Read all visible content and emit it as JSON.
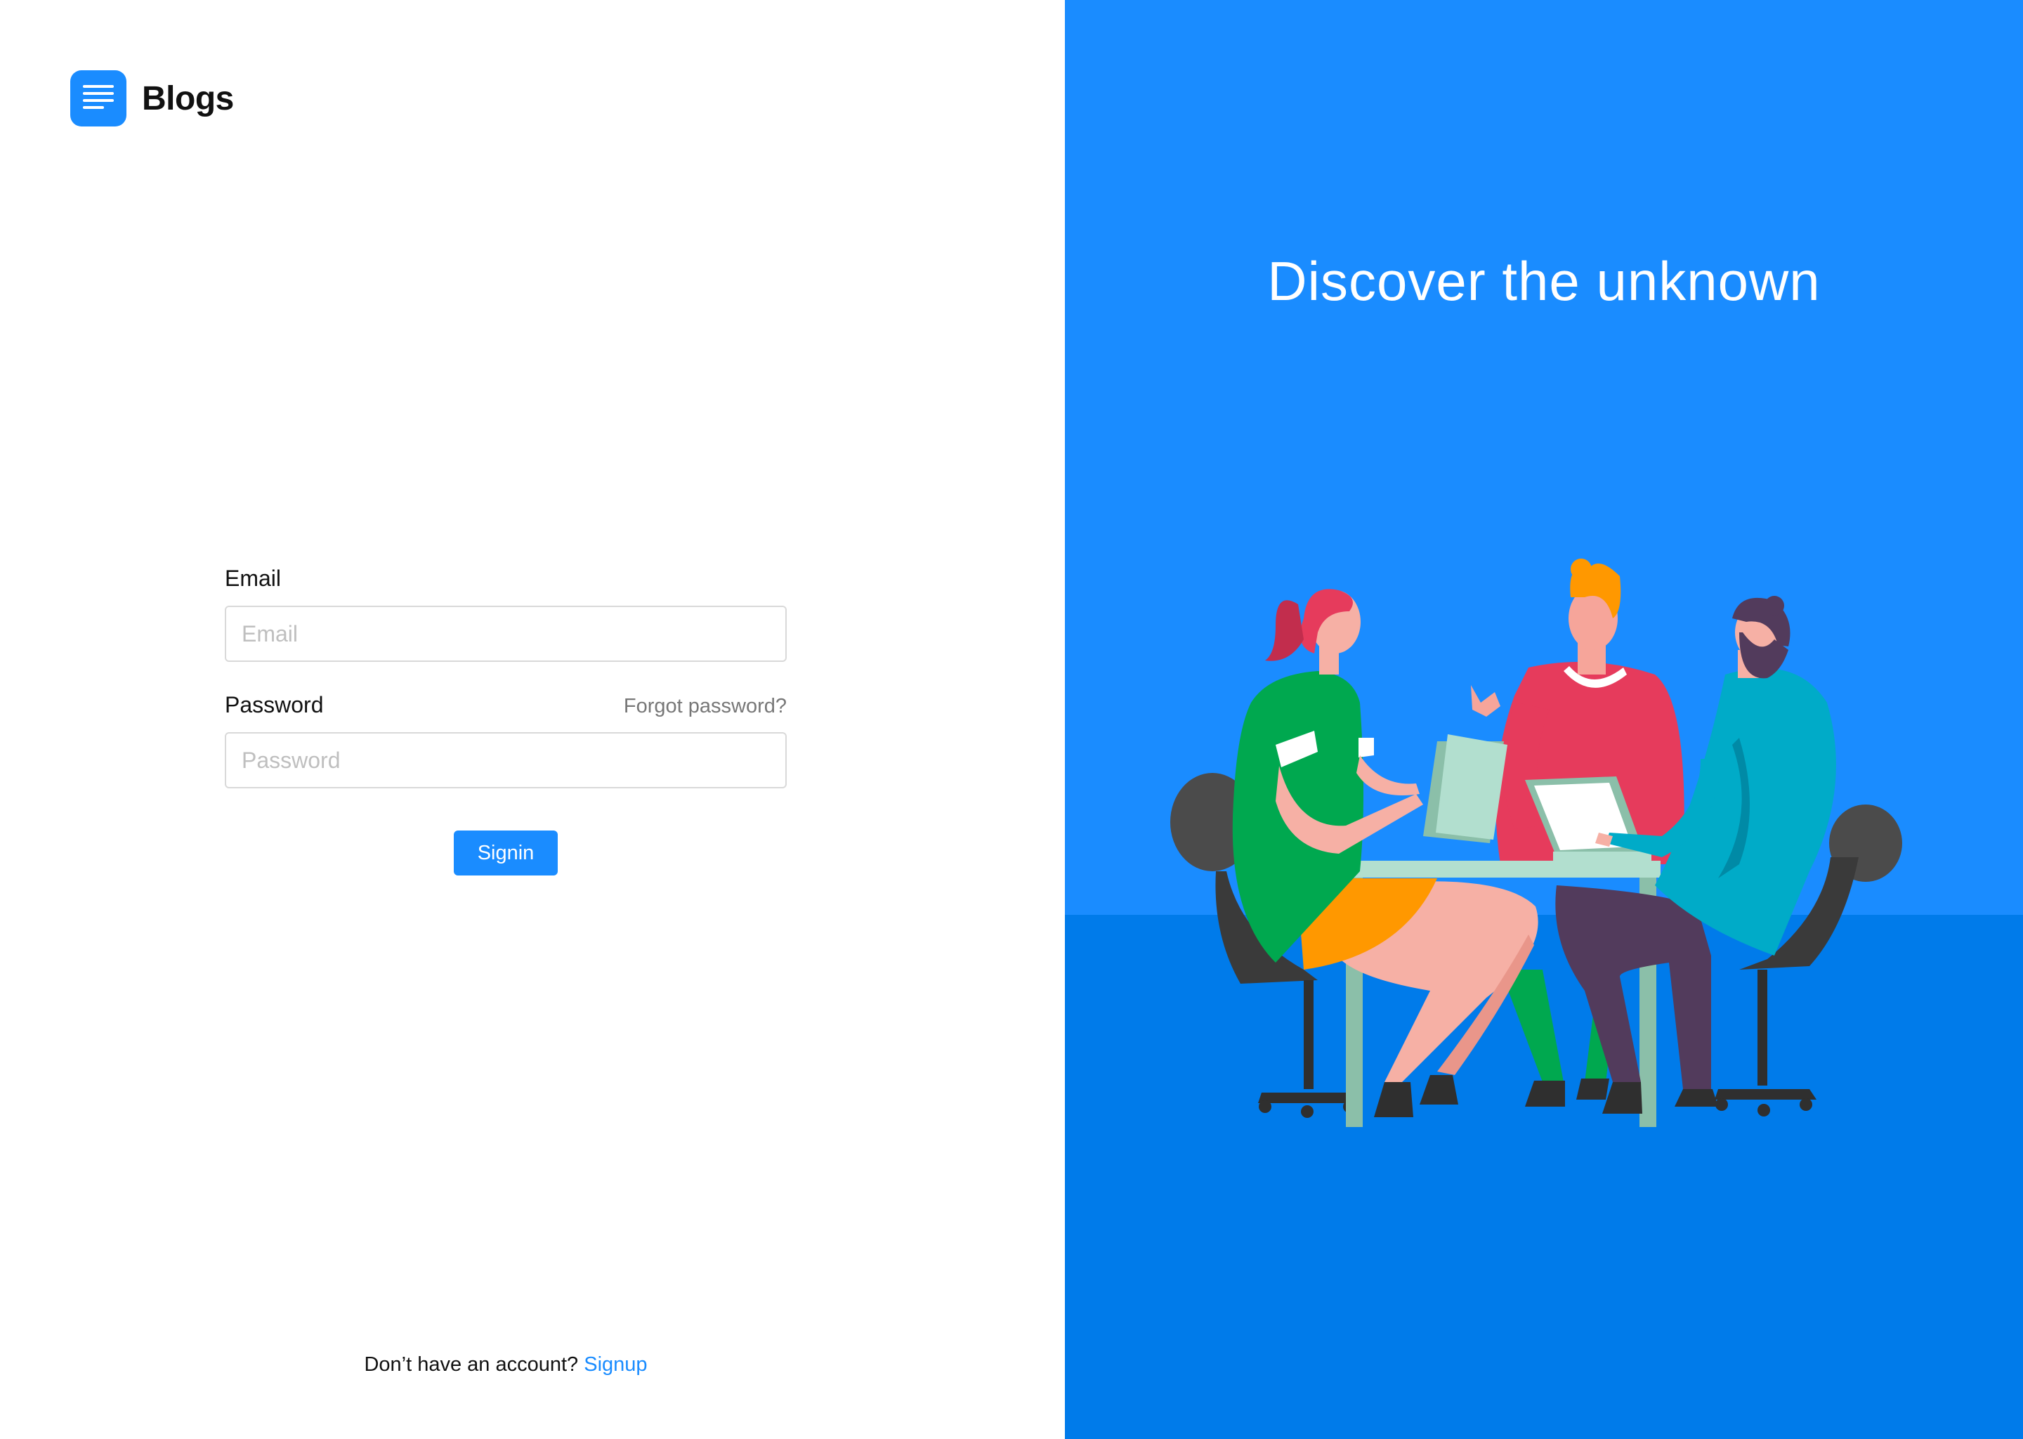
{
  "brand": {
    "name": "Blogs",
    "logo_icon": "document-lines-icon",
    "accent_color": "#1a8cff"
  },
  "form": {
    "email": {
      "label": "Email",
      "placeholder": "Email",
      "value": ""
    },
    "password": {
      "label": "Password",
      "placeholder": "Password",
      "value": "",
      "forgot_label": "Forgot password?"
    },
    "signin_label": "Signin"
  },
  "footer": {
    "prompt": "Don’t have an account?",
    "signup_label": "Signup"
  },
  "hero": {
    "tagline": "Discover the unknown",
    "background_color": "#1a8cff",
    "floor_color": "#007bea",
    "illustration": "three-people-meeting-illustration"
  }
}
